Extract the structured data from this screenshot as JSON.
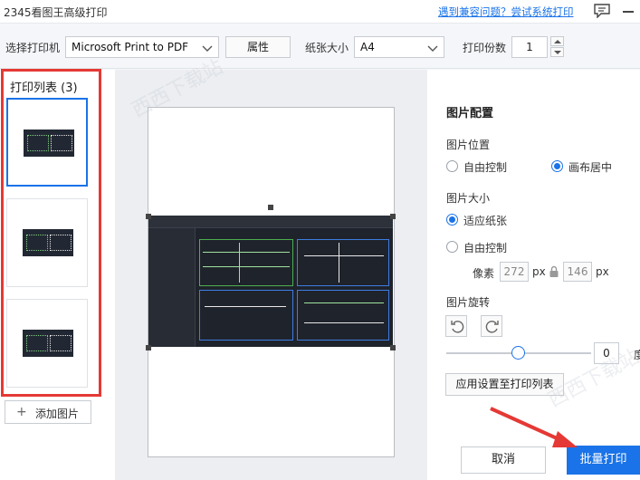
{
  "titlebar": {
    "title": "2345看图王高级打印",
    "compat_link": "遇到兼容问题？尝试系统打印"
  },
  "toolbar": {
    "printer_label": "选择打印机",
    "printer_value": "Microsoft Print to PDF",
    "properties_button": "属性",
    "paper_label": "纸张大小",
    "paper_value": "A4",
    "copies_label": "打印份数",
    "copies_value": "1"
  },
  "print_list": {
    "title": "打印列表 (3)",
    "add_button": "添加图片",
    "items": [
      {
        "selected": true
      },
      {
        "selected": false
      },
      {
        "selected": false
      }
    ]
  },
  "config": {
    "title": "图片配置",
    "position": {
      "label": "图片位置",
      "options": [
        "自由控制",
        "画布居中"
      ],
      "selected": "画布居中"
    },
    "size": {
      "label": "图片大小",
      "option_fit": "适应纸张",
      "option_free": "自由控制",
      "selected": "适应纸张",
      "pixel_label": "像素",
      "width": "272",
      "height": "146",
      "unit": "px"
    },
    "rotation": {
      "label": "图片旋转",
      "value": "0",
      "unit": "度"
    },
    "apply_button": "应用设置至打印列表"
  },
  "footer": {
    "cancel_button": "取消",
    "print_button": "批量打印"
  },
  "watermark": "西西下载站",
  "colors": {
    "accent": "#1a73e8",
    "highlight_red": "#e53935"
  }
}
